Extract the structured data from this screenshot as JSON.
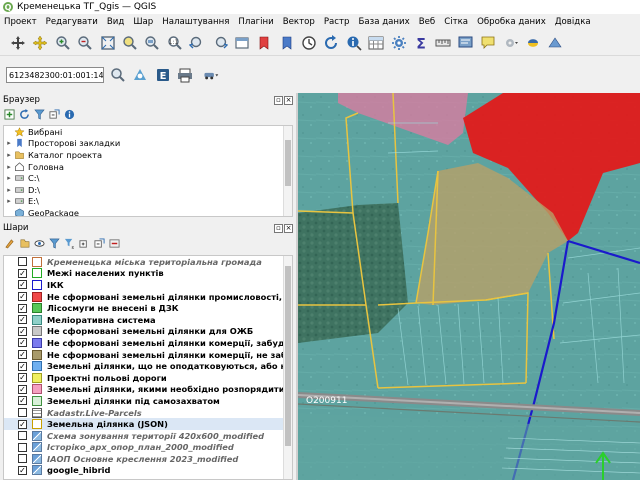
{
  "window": {
    "title": "Кременецька ТГ_Qgis — QGIS"
  },
  "menu": [
    "Проект",
    "Редагувати",
    "Вид",
    "Шар",
    "Налаштування",
    "Плагіни",
    "Вектор",
    "Растр",
    "База даних",
    "Веб",
    "Сітка",
    "Обробка даних",
    "Довідка"
  ],
  "toolbar2": {
    "coord_value": "6123482300:01:001:1464"
  },
  "browser": {
    "title": "Браузер",
    "items": [
      {
        "label": "Вибрані",
        "icon": "star-icon",
        "expandable": false
      },
      {
        "label": "Просторові закладки",
        "icon": "bookmark-icon",
        "expandable": true
      },
      {
        "label": "Каталог проекта",
        "icon": "folder-icon",
        "expandable": true
      },
      {
        "label": "Головна",
        "icon": "home-icon",
        "expandable": true
      },
      {
        "label": "C:\\",
        "icon": "drive-icon",
        "expandable": true
      },
      {
        "label": "D:\\",
        "icon": "drive-icon",
        "expandable": true
      },
      {
        "label": "E:\\",
        "icon": "drive-icon",
        "expandable": true
      },
      {
        "label": "GeoPackage",
        "icon": "geopackage-icon",
        "expandable": false
      }
    ]
  },
  "layers": {
    "title": "Шари",
    "items": [
      {
        "label": "Кременецька міська територіальна громада",
        "checked": false,
        "color": "#ffffff",
        "border": "#c0703a",
        "style": "ital"
      },
      {
        "label": "Межі населених пунктів",
        "checked": true,
        "color": "#ffffff",
        "border": "#22aa22",
        "style": "bold"
      },
      {
        "label": "ІКК",
        "checked": true,
        "color": "#ffffff",
        "border": "#1a1acc",
        "style": "bold"
      },
      {
        "label": "Не сформовані земельні ділянки промисловості, транпорту та зв",
        "checked": true,
        "color": "#f04848",
        "border": "#a02020",
        "style": "bold"
      },
      {
        "label": "Лісосмуги не внесені в ДЗК",
        "checked": true,
        "color": "#58c858",
        "border": "#2a802a",
        "style": "bold"
      },
      {
        "label": "Меліоративна система",
        "checked": true,
        "color": "#8fd0c8",
        "border": "#3a8a80",
        "style": "bold"
      },
      {
        "label": "Не сформовані земельні ділянки для ОЖБ",
        "checked": true,
        "color": "#c8c8c8",
        "border": "#777777",
        "style": "bold"
      },
      {
        "label": "Не сформовані земельні ділянки комерції, забудовані",
        "checked": true,
        "color": "#7a7aee",
        "border": "#3a3aaa",
        "style": "bold"
      },
      {
        "label": "Не сформовані земельні ділянки комерції, не забудовані",
        "checked": true,
        "color": "#a89a6a",
        "border": "#6a5a30",
        "style": "bold"
      },
      {
        "label": "Земельні ділянки, що не оподатковуються, або належать до пільг",
        "checked": true,
        "color": "#70b0f0",
        "border": "#3070b0",
        "style": "bold"
      },
      {
        "label": "Проектні польові дороги",
        "checked": true,
        "color": "#f0f060",
        "border": "#a0a020",
        "style": "bold"
      },
      {
        "label": "Земельні ділянки, якими необхідно розпорядитися",
        "checked": true,
        "color": "#f4a0c0",
        "border": "#b05070",
        "style": "bold"
      },
      {
        "label": "Земельні ділянки під самозахватом",
        "checked": true,
        "color": "#d8f0d8",
        "border": "#409040",
        "style": "bold"
      },
      {
        "label": "Kadastr.Live-Parcels",
        "checked": false,
        "color": "grid",
        "border": "#888888",
        "style": "ital"
      },
      {
        "label": "Земельна ділянка (JSON)",
        "checked": true,
        "color": "#ffffff",
        "border": "#c8a000",
        "style": "bold"
      },
      {
        "label": "Схема зонування території 420х600_modified",
        "checked": false,
        "color": "raster",
        "border": "#888888",
        "style": "ital"
      },
      {
        "label": "Історіко_арх_опор_план_2000_modified",
        "checked": false,
        "color": "raster",
        "border": "#888888",
        "style": "ital"
      },
      {
        "label": "ІАОП Основне креслення 2023_modified",
        "checked": false,
        "color": "raster",
        "border": "#888888",
        "style": "ital"
      },
      {
        "label": "google_hibrid",
        "checked": true,
        "color": "raster",
        "border": "#888888",
        "style": "bold"
      }
    ]
  },
  "map": {
    "road_label": "O200911"
  }
}
